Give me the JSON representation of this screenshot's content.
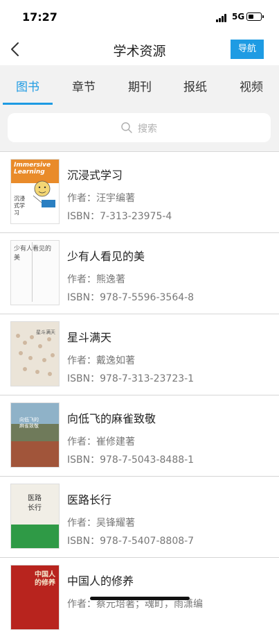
{
  "status": {
    "time": "17:27",
    "network": "5G"
  },
  "header": {
    "title": "学术资源",
    "nav_label": "导航"
  },
  "tabs": [
    {
      "label": "图书",
      "active": true
    },
    {
      "label": "章节",
      "active": false
    },
    {
      "label": "期刊",
      "active": false
    },
    {
      "label": "报纸",
      "active": false
    },
    {
      "label": "视频",
      "active": false
    }
  ],
  "search": {
    "placeholder": "搜索"
  },
  "books": [
    {
      "title": "沉浸式学习",
      "author": "作者：汪宇编著",
      "isbn": "ISBN：7-313-23975-4",
      "cover_text": "Immersive Learning",
      "cover_cn": "沉浸式学习"
    },
    {
      "title": "少有人看见的美",
      "author": "作者：熊逸著",
      "isbn": "ISBN：978-7-5596-3564-8",
      "cover_text": "少有人看见的美"
    },
    {
      "title": "星斗满天",
      "author": "作者：戴逸如著",
      "isbn": "ISBN：978-7-313-23723-1",
      "cover_text": "星斗满天"
    },
    {
      "title": "向低飞的麻雀致敬",
      "author": "作者：崔修建著",
      "isbn": "ISBN：978-7-5043-8488-1",
      "cover_text": "向低飞的麻雀致敬"
    },
    {
      "title": "医路长行",
      "author": "作者：吴锋耀著",
      "isbn": "ISBN：978-7-5407-8808-7",
      "cover_text": "医路长行"
    },
    {
      "title": "中国人的修养",
      "author": "作者：蔡元培著；魂町，雨潇编",
      "isbn": "",
      "cover_text": "中国人的修养"
    }
  ],
  "colors": {
    "accent": "#1e9be3",
    "tab_bg": "#f2f2f2"
  }
}
